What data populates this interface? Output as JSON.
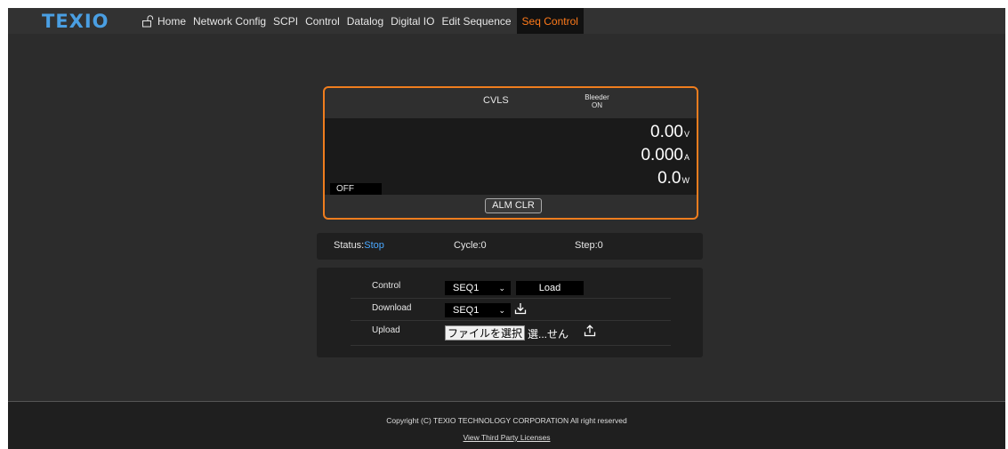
{
  "brand": {
    "logo_text": "TEXIO",
    "accent": "#ef7d1e",
    "logo_color": "#4a9fe3"
  },
  "nav": {
    "items": [
      {
        "label": "Home",
        "icon": "lock-open-icon"
      },
      {
        "label": "Network Config"
      },
      {
        "label": "SCPI"
      },
      {
        "label": "Control"
      },
      {
        "label": "Datalog"
      },
      {
        "label": "Digital IO"
      },
      {
        "label": "Edit Sequence"
      },
      {
        "label": "Seq Control",
        "active": true
      }
    ]
  },
  "display": {
    "mode": "CVLS",
    "bleeder_label": "Bleeder",
    "bleeder_state": "ON",
    "voltage": "0.00",
    "voltage_unit": "V",
    "current": "0.000",
    "current_unit": "A",
    "power": "0.0",
    "power_unit": "W",
    "output_state": "OFF",
    "alm_clr_label": "ALM CLR"
  },
  "status": {
    "status_label": "Status:",
    "status_value": "Stop",
    "cycle": "Cycle:0",
    "step": "Step:0"
  },
  "control": {
    "control_label": "Control",
    "control_select": "SEQ1",
    "load_label": "Load",
    "download_label": "Download",
    "download_select": "SEQ1",
    "upload_label": "Upload",
    "file_button_label": "ファイルを選択",
    "file_name": "選...せん"
  },
  "footer": {
    "copyright": "Copyright (C) TEXIO TECHNOLOGY CORPORATION All right reserved",
    "licenses_link": "View Third Party Licenses"
  }
}
